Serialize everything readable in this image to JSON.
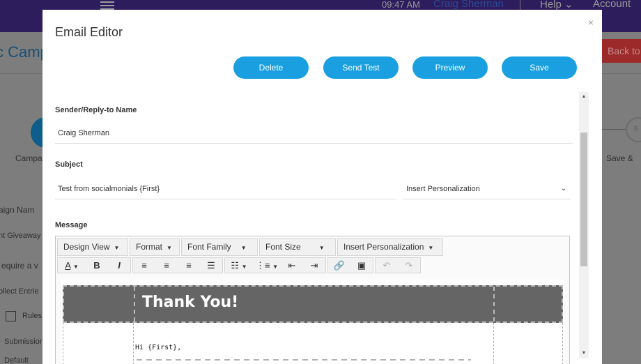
{
  "background": {
    "time": "09:47 AM",
    "user": "Craig Sherman",
    "help": "Help ⌄",
    "account": "Account",
    "page_title": "c Camp",
    "back_button": "Back to",
    "step_label_left": "Campa",
    "step_label_right": "Save &",
    "step_circle_right": "5",
    "campaign_name_label": "aign Nam",
    "campaign_name_value": "nt Giveaway",
    "require_label": "equire a v",
    "collect_label": "ollect Entrie",
    "rules_label": "Rules",
    "submission_label": "Submission",
    "default_label": "Default"
  },
  "modal": {
    "title": "Email Editor",
    "close_icon": "×",
    "buttons": {
      "delete": "Delete",
      "send_test": "Send Test",
      "preview": "Preview",
      "save": "Save"
    },
    "sender_label": "Sender/Reply-to Name",
    "sender_value": "Craig Sherman",
    "subject_label": "Subject",
    "subject_value": "Test from socialmonials {First}",
    "personalization_select": "Insert Personalization",
    "message_label": "Message"
  },
  "toolbar": {
    "design_view": "Design View",
    "format": "Format",
    "font_family": "Font Family",
    "font_size": "Font Size",
    "insert_personalization": "Insert Personalization",
    "icons": [
      "text-color-icon",
      "bold-icon",
      "italic-icon",
      "align-left-icon",
      "align-center-icon",
      "align-right-icon",
      "align-justify-icon",
      "bullet-list-icon",
      "numbered-list-icon",
      "outdent-icon",
      "indent-icon",
      "link-icon",
      "image-icon",
      "undo-icon",
      "redo-icon"
    ]
  },
  "email": {
    "header_text": "Thank You!",
    "greeting": "Hi {First},"
  },
  "colors": {
    "accent": "#1aa0e0",
    "header_band": "#656565",
    "topbar": "#2d1d5c",
    "back_button": "#9c2a2a"
  }
}
